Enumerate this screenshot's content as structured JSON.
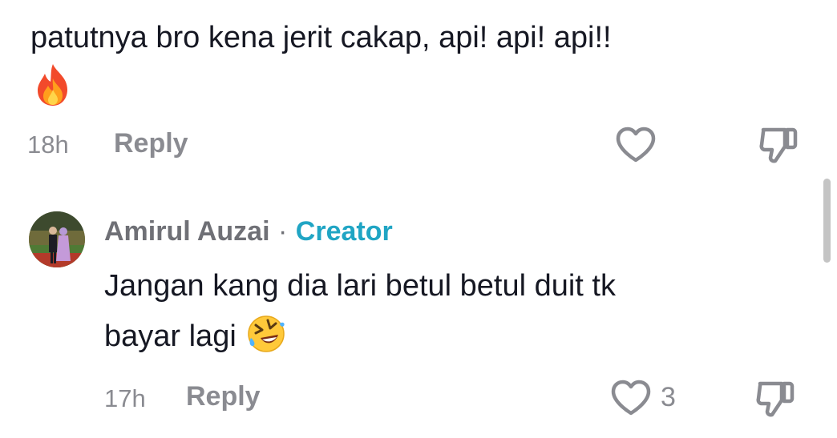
{
  "comments": [
    {
      "text": "patutnya bro kena jerit cakap, api! api! api!!",
      "emoji": "fire",
      "time": "18h",
      "reply_label": "Reply",
      "like_count": ""
    },
    {
      "author": "Amirul Auzai",
      "separator": "·",
      "badge": "Creator",
      "text_line1": "Jangan kang dia lari betul betul duit tk",
      "text_line2": "bayar lagi",
      "emoji": "rolling-on-floor-laughing",
      "time": "17h",
      "reply_label": "Reply",
      "like_count": "3"
    }
  ],
  "colors": {
    "text": "#161823",
    "muted": "#8a8b91",
    "creator_badge": "#20a5c4"
  }
}
